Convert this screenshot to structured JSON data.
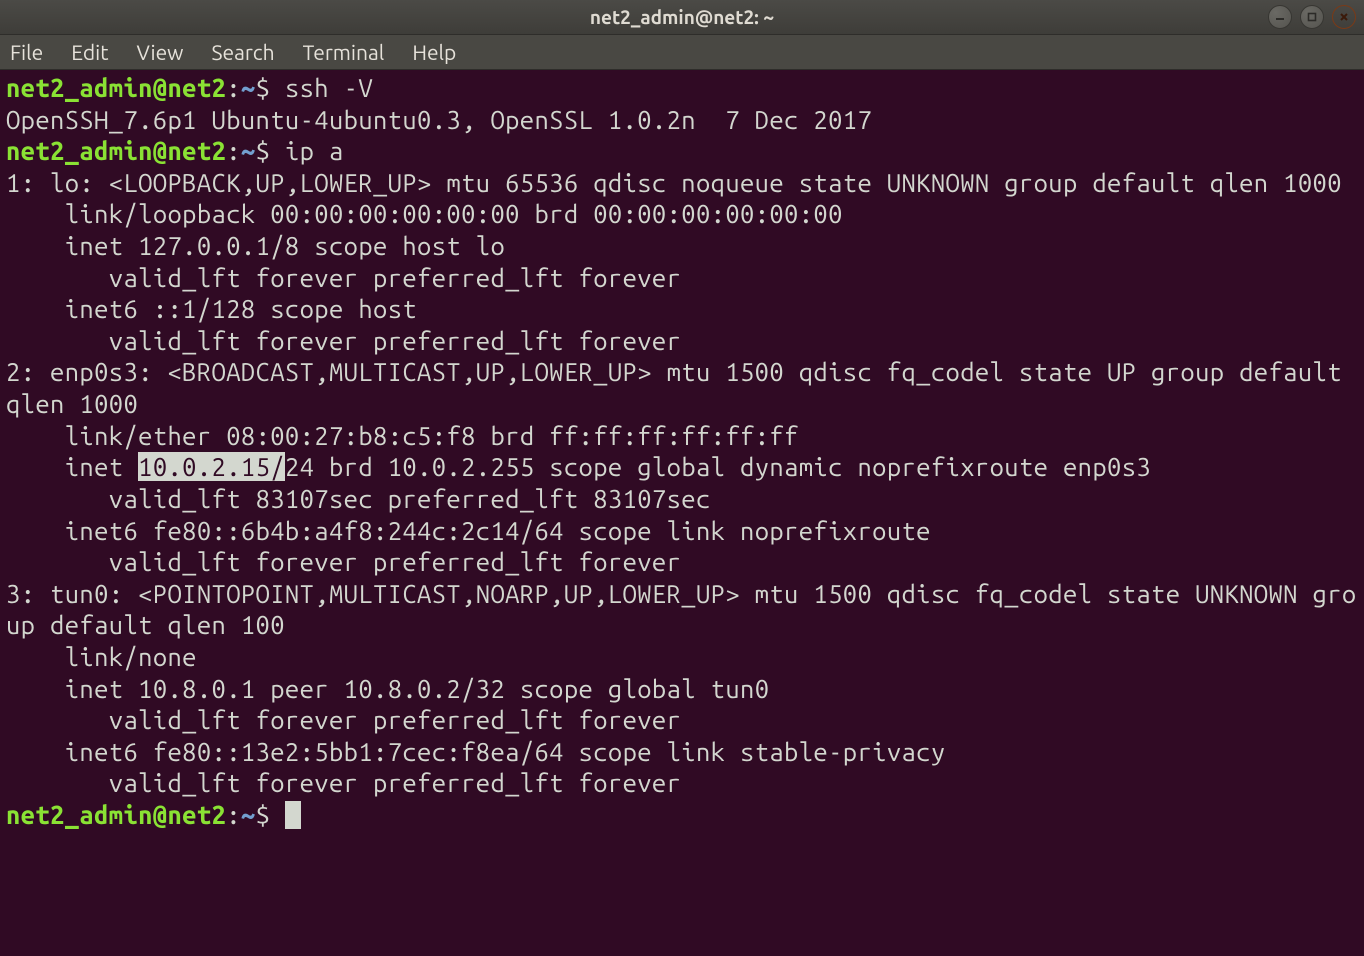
{
  "titlebar": {
    "title": "net2_admin@net2: ~"
  },
  "menubar": {
    "items": [
      "File",
      "Edit",
      "View",
      "Search",
      "Terminal",
      "Help"
    ]
  },
  "prompt": {
    "user_host": "net2_admin@net2",
    "colon": ":",
    "path": "~",
    "dollar": "$"
  },
  "session": {
    "cmd1": " ssh -V",
    "out1": "OpenSSH_7.6p1 Ubuntu-4ubuntu0.3, OpenSSL 1.0.2n  7 Dec 2017",
    "cmd2": " ip a",
    "ipa": {
      "l1": "1: lo: <LOOPBACK,UP,LOWER_UP> mtu 65536 qdisc noqueue state UNKNOWN group default qlen 1000",
      "l2": "    link/loopback 00:00:00:00:00:00 brd 00:00:00:00:00:00",
      "l3": "    inet 127.0.0.1/8 scope host lo",
      "l4": "       valid_lft forever preferred_lft forever",
      "l5": "    inet6 ::1/128 scope host ",
      "l6": "       valid_lft forever preferred_lft forever",
      "l7": "2: enp0s3: <BROADCAST,MULTICAST,UP,LOWER_UP> mtu 1500 qdisc fq_codel state UP group default qlen 1000",
      "l8": "    link/ether 08:00:27:b8:c5:f8 brd ff:ff:ff:ff:ff:ff",
      "l9a": "    inet ",
      "l9hl": "10.0.2.15/",
      "l9b": "24 brd 10.0.2.255 scope global dynamic noprefixroute enp0s3",
      "l10": "       valid_lft 83107sec preferred_lft 83107sec",
      "l11": "    inet6 fe80::6b4b:a4f8:244c:2c14/64 scope link noprefixroute ",
      "l12": "       valid_lft forever preferred_lft forever",
      "l13": "3: tun0: <POINTOPOINT,MULTICAST,NOARP,UP,LOWER_UP> mtu 1500 qdisc fq_codel state UNKNOWN group default qlen 100",
      "l14": "    link/none ",
      "l15": "    inet 10.8.0.1 peer 10.8.0.2/32 scope global tun0",
      "l16": "       valid_lft forever preferred_lft forever",
      "l17": "    inet6 fe80::13e2:5bb1:7cec:f8ea/64 scope link stable-privacy ",
      "l18": "       valid_lft forever preferred_lft forever"
    },
    "cmd3": " "
  }
}
